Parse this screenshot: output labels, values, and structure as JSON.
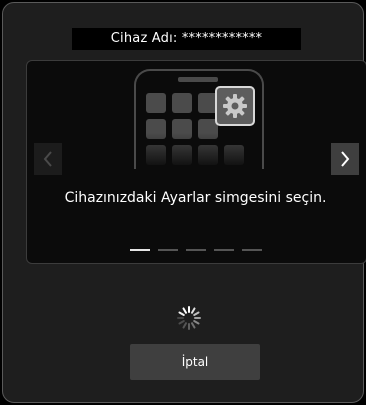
{
  "device": {
    "label": "Cihaz Adı: ************"
  },
  "illustration": {
    "phone_icon": "phone-outline-icon",
    "settings_icon": "gear-icon",
    "app_grid_icon": "app-tile-icon"
  },
  "carousel": {
    "instruction": "Cihazınızdaki Ayarlar simgesini seçin.",
    "page_count": 5,
    "current_page": 1,
    "prev_icon": "chevron-left-icon",
    "next_icon": "chevron-right-icon"
  },
  "status": {
    "spinner_icon": "loading-spinner-icon"
  },
  "actions": {
    "cancel_label": "İptal"
  },
  "colors": {
    "background": "#1e1e1e",
    "panel": "#0b0b0b",
    "accent_tile": "#5d5d5d",
    "button": "#3f3f3f",
    "text": "#ffffff"
  }
}
